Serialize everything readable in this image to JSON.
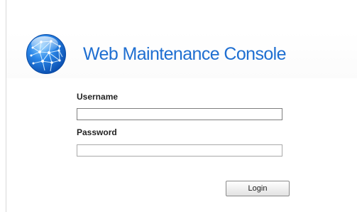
{
  "header": {
    "app_title": "Web Maintenance Console",
    "logo_icon": "globe-network-icon"
  },
  "login_form": {
    "username_label": "Username",
    "username_value": "",
    "password_label": "Password",
    "password_value": "",
    "login_button_label": "Login"
  },
  "colors": {
    "title_blue": "#1f6fd1",
    "globe_blue": "#1a6fd6",
    "label_text": "#222222",
    "border_gray": "#7f7f7f"
  }
}
